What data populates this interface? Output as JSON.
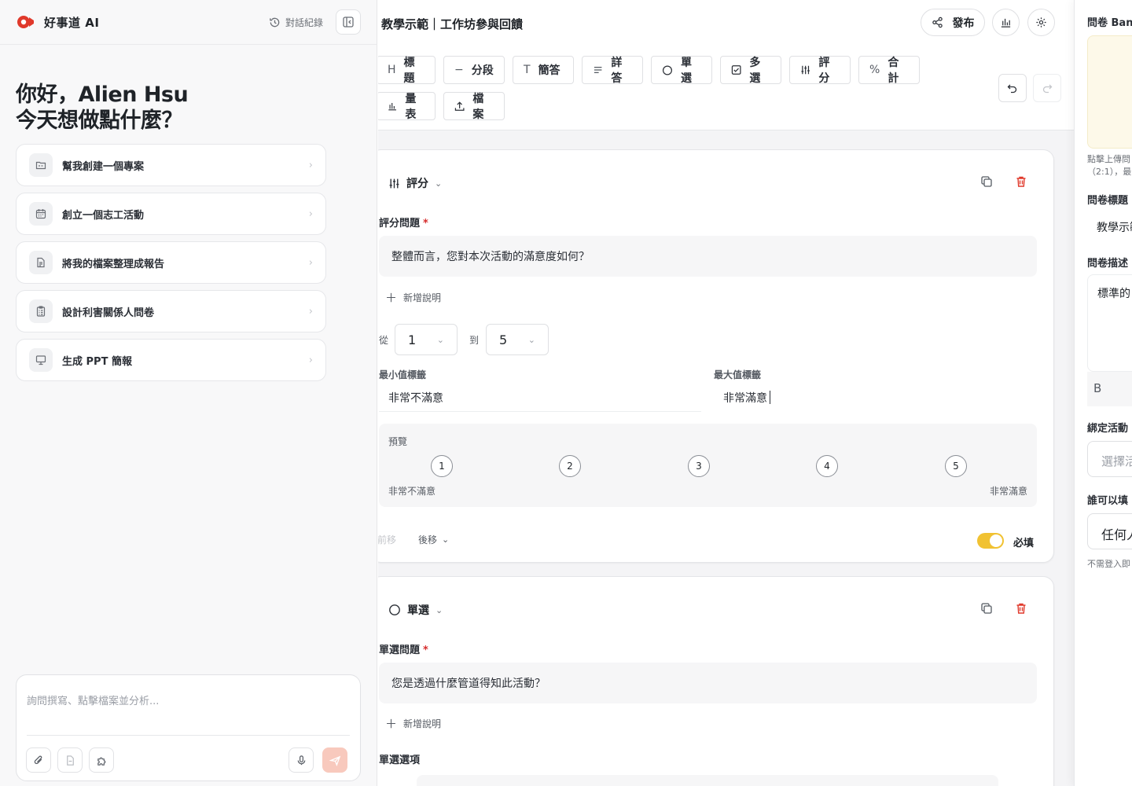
{
  "chat": {
    "app_name": "好事道 AI",
    "history_label": "對話紀錄",
    "greeting_line1": "你好，Alien Hsu",
    "greeting_line2": "今天想做點什麼？",
    "suggestions": [
      {
        "label": "幫我創建一個專案",
        "icon": "folder-icon"
      },
      {
        "label": "創立一個志工活動",
        "icon": "calendar-icon"
      },
      {
        "label": "將我的檔案整理成報告",
        "icon": "document-icon"
      },
      {
        "label": "設計利害關係人問卷",
        "icon": "clipboard-icon"
      },
      {
        "label": "生成 PPT 簡報",
        "icon": "presentation-icon"
      }
    ],
    "composer_placeholder": "詢問撰寫、點擊檔案並分析..."
  },
  "editor": {
    "title": "教學示範｜工作坊參與回饋",
    "publish_label": "發布",
    "toolbar": [
      {
        "label": "標題",
        "icon": "heading-icon"
      },
      {
        "label": "分段",
        "icon": "divider-icon"
      },
      {
        "label": "簡答",
        "icon": "text-icon"
      },
      {
        "label": "詳答",
        "icon": "paragraph-icon"
      },
      {
        "label": "單選",
        "icon": "radio-icon"
      },
      {
        "label": "多選",
        "icon": "checkbox-icon"
      },
      {
        "label": "評分",
        "icon": "sliders-icon"
      },
      {
        "label": "合計",
        "icon": "percent-icon"
      },
      {
        "label": "量表",
        "icon": "bar-chart-icon"
      },
      {
        "label": "檔案",
        "icon": "upload-icon"
      }
    ],
    "q1": {
      "type_label": "評分",
      "question_label": "評分問題",
      "required_mark": "*",
      "question_text": "整體而言，您對本次活動的滿意度如何？",
      "add_description": "新增說明",
      "from_label": "從",
      "from_value": "1",
      "to_label": "到",
      "to_value": "5",
      "min_label_title": "最小值標籤",
      "min_label_value": "非常不滿意",
      "max_label_title": "最大值標籤",
      "max_label_value": "非常滿意",
      "preview_label": "預覽",
      "scale": [
        "1",
        "2",
        "3",
        "4",
        "5"
      ],
      "preview_min": "非常不滿意",
      "preview_max": "非常滿意",
      "move_up": "前移",
      "move_down": "後移",
      "required_label": "必填",
      "required": true
    },
    "q2": {
      "type_label": "單選",
      "question_label": "單選問題",
      "required_mark": "*",
      "question_text": "您是透過什麼管道得知此活動？",
      "add_description": "新增說明",
      "options_label": "單選選項"
    }
  },
  "settings": {
    "banner_label": "問卷 Ban",
    "upload_hint_1": "點擊上傳問",
    "upload_hint_2": "（2:1），最",
    "title_label": "問卷標題",
    "title_value": "教學示範",
    "desc_label": "問卷描述",
    "desc_value": "標準的",
    "bold_label": "B",
    "bind_label": "綁定活動",
    "bind_placeholder": "選擇活",
    "who_label": "誰可以填",
    "who_value": "任何人",
    "who_hint": "不需登入即"
  },
  "colors": {
    "accent_red": "#e0392b",
    "toggle_on": "#f1c232",
    "send_disabled": "#f8c9bd"
  }
}
